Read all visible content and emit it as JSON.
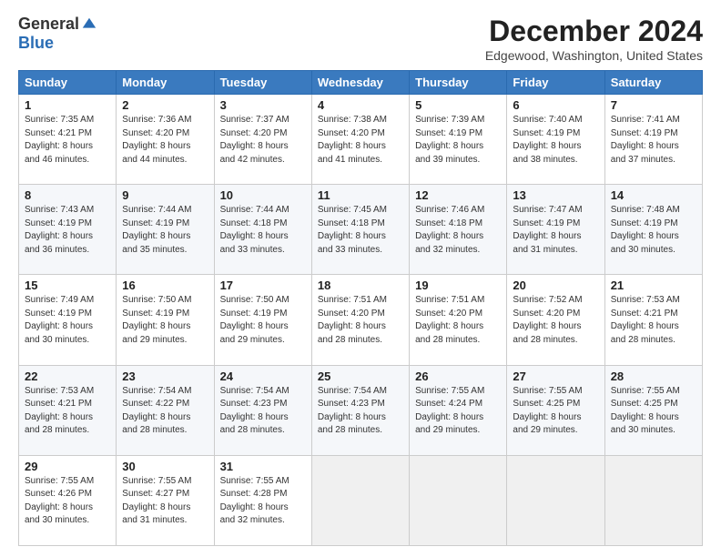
{
  "logo": {
    "general": "General",
    "blue": "Blue"
  },
  "title": "December 2024",
  "location": "Edgewood, Washington, United States",
  "days_of_week": [
    "Sunday",
    "Monday",
    "Tuesday",
    "Wednesday",
    "Thursday",
    "Friday",
    "Saturday"
  ],
  "weeks": [
    [
      {
        "day": "1",
        "sunrise": "7:35 AM",
        "sunset": "4:21 PM",
        "daylight": "8 hours and 46 minutes."
      },
      {
        "day": "2",
        "sunrise": "7:36 AM",
        "sunset": "4:20 PM",
        "daylight": "8 hours and 44 minutes."
      },
      {
        "day": "3",
        "sunrise": "7:37 AM",
        "sunset": "4:20 PM",
        "daylight": "8 hours and 42 minutes."
      },
      {
        "day": "4",
        "sunrise": "7:38 AM",
        "sunset": "4:20 PM",
        "daylight": "8 hours and 41 minutes."
      },
      {
        "day": "5",
        "sunrise": "7:39 AM",
        "sunset": "4:19 PM",
        "daylight": "8 hours and 39 minutes."
      },
      {
        "day": "6",
        "sunrise": "7:40 AM",
        "sunset": "4:19 PM",
        "daylight": "8 hours and 38 minutes."
      },
      {
        "day": "7",
        "sunrise": "7:41 AM",
        "sunset": "4:19 PM",
        "daylight": "8 hours and 37 minutes."
      }
    ],
    [
      {
        "day": "8",
        "sunrise": "7:43 AM",
        "sunset": "4:19 PM",
        "daylight": "8 hours and 36 minutes."
      },
      {
        "day": "9",
        "sunrise": "7:44 AM",
        "sunset": "4:19 PM",
        "daylight": "8 hours and 35 minutes."
      },
      {
        "day": "10",
        "sunrise": "7:44 AM",
        "sunset": "4:18 PM",
        "daylight": "8 hours and 33 minutes."
      },
      {
        "day": "11",
        "sunrise": "7:45 AM",
        "sunset": "4:18 PM",
        "daylight": "8 hours and 33 minutes."
      },
      {
        "day": "12",
        "sunrise": "7:46 AM",
        "sunset": "4:18 PM",
        "daylight": "8 hours and 32 minutes."
      },
      {
        "day": "13",
        "sunrise": "7:47 AM",
        "sunset": "4:19 PM",
        "daylight": "8 hours and 31 minutes."
      },
      {
        "day": "14",
        "sunrise": "7:48 AM",
        "sunset": "4:19 PM",
        "daylight": "8 hours and 30 minutes."
      }
    ],
    [
      {
        "day": "15",
        "sunrise": "7:49 AM",
        "sunset": "4:19 PM",
        "daylight": "8 hours and 30 minutes."
      },
      {
        "day": "16",
        "sunrise": "7:50 AM",
        "sunset": "4:19 PM",
        "daylight": "8 hours and 29 minutes."
      },
      {
        "day": "17",
        "sunrise": "7:50 AM",
        "sunset": "4:19 PM",
        "daylight": "8 hours and 29 minutes."
      },
      {
        "day": "18",
        "sunrise": "7:51 AM",
        "sunset": "4:20 PM",
        "daylight": "8 hours and 28 minutes."
      },
      {
        "day": "19",
        "sunrise": "7:51 AM",
        "sunset": "4:20 PM",
        "daylight": "8 hours and 28 minutes."
      },
      {
        "day": "20",
        "sunrise": "7:52 AM",
        "sunset": "4:20 PM",
        "daylight": "8 hours and 28 minutes."
      },
      {
        "day": "21",
        "sunrise": "7:53 AM",
        "sunset": "4:21 PM",
        "daylight": "8 hours and 28 minutes."
      }
    ],
    [
      {
        "day": "22",
        "sunrise": "7:53 AM",
        "sunset": "4:21 PM",
        "daylight": "8 hours and 28 minutes."
      },
      {
        "day": "23",
        "sunrise": "7:54 AM",
        "sunset": "4:22 PM",
        "daylight": "8 hours and 28 minutes."
      },
      {
        "day": "24",
        "sunrise": "7:54 AM",
        "sunset": "4:23 PM",
        "daylight": "8 hours and 28 minutes."
      },
      {
        "day": "25",
        "sunrise": "7:54 AM",
        "sunset": "4:23 PM",
        "daylight": "8 hours and 28 minutes."
      },
      {
        "day": "26",
        "sunrise": "7:55 AM",
        "sunset": "4:24 PM",
        "daylight": "8 hours and 29 minutes."
      },
      {
        "day": "27",
        "sunrise": "7:55 AM",
        "sunset": "4:25 PM",
        "daylight": "8 hours and 29 minutes."
      },
      {
        "day": "28",
        "sunrise": "7:55 AM",
        "sunset": "4:25 PM",
        "daylight": "8 hours and 30 minutes."
      }
    ],
    [
      {
        "day": "29",
        "sunrise": "7:55 AM",
        "sunset": "4:26 PM",
        "daylight": "8 hours and 30 minutes."
      },
      {
        "day": "30",
        "sunrise": "7:55 AM",
        "sunset": "4:27 PM",
        "daylight": "8 hours and 31 minutes."
      },
      {
        "day": "31",
        "sunrise": "7:55 AM",
        "sunset": "4:28 PM",
        "daylight": "8 hours and 32 minutes."
      },
      null,
      null,
      null,
      null
    ]
  ],
  "labels": {
    "sunrise": "Sunrise:",
    "sunset": "Sunset:",
    "daylight": "Daylight:"
  }
}
